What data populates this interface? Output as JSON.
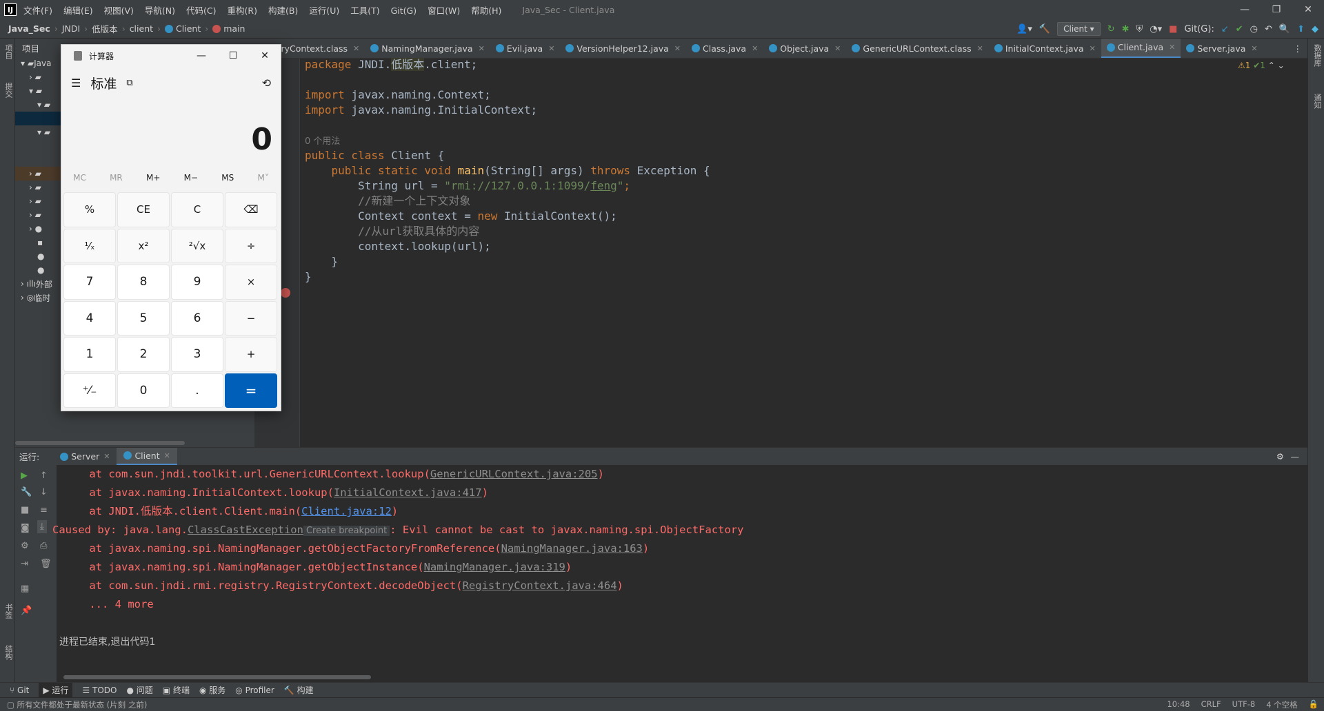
{
  "titlebar": {
    "logo": "IJ",
    "menu": [
      "文件(F)",
      "编辑(E)",
      "视图(V)",
      "导航(N)",
      "代码(C)",
      "重构(R)",
      "构建(B)",
      "运行(U)",
      "工具(T)",
      "Git(G)",
      "窗口(W)",
      "帮助(H)"
    ],
    "window_title": "Java_Sec - Client.java",
    "minimize": "—",
    "restore": "❐",
    "close": "✕"
  },
  "navbar": {
    "breadcrumbs": [
      "Java_Sec",
      "JNDI",
      "低版本",
      "client",
      "Client",
      "main"
    ],
    "run_config": "Client",
    "git_label": "Git(G):"
  },
  "left_strip": {
    "project": "项目",
    "commit": "提交",
    "bookmarks": "书签",
    "structure": "结构"
  },
  "right_strip": {
    "database": "数据库",
    "notifications": "通知"
  },
  "project_panel": {
    "title": "项目",
    "rows": [
      "Java",
      "",
      "",
      "",
      "",
      "",
      "",
      "",
      "",
      "",
      "",
      "",
      "",
      "",
      "",
      "外部",
      "临时"
    ]
  },
  "editor_tabs": [
    {
      "label": "egistryContext.class",
      "active": false
    },
    {
      "label": "NamingManager.java",
      "active": false
    },
    {
      "label": "Evil.java",
      "active": false
    },
    {
      "label": "VersionHelper12.java",
      "active": false
    },
    {
      "label": "Class.java",
      "active": false
    },
    {
      "label": "Object.java",
      "active": false
    },
    {
      "label": "GenericURLContext.class",
      "active": false
    },
    {
      "label": "InitialContext.java",
      "active": false
    },
    {
      "label": "Client.java",
      "active": true
    },
    {
      "label": "Server.java",
      "active": false
    }
  ],
  "inspection": {
    "warnings": "⚠1",
    "ok": "✔1"
  },
  "code": {
    "l1_kw": "package ",
    "l1_pkg1": "JNDI.",
    "l1_pkg2": "低版本",
    "l1_pkg3": ".client;",
    "l3_kw": "import ",
    "l3_rest": "javax.naming.Context;",
    "l4_kw": "import ",
    "l4_rest": "javax.naming.InitialContext;",
    "usage_hint": "0 个用法",
    "l6_kw": "public class ",
    "l6_rest": "Client {",
    "l7_kw1": "    public static void ",
    "l7_fn": "main",
    "l7_mid": "(String[] args) ",
    "l7_kw2": "throws ",
    "l7_end": "Exception {",
    "l8_a": "        String url = ",
    "l8_str1": "\"rmi://127.0.0.1:1099/",
    "l8_str2": "feng",
    "l8_str3": "\"",
    "l8_end": ";",
    "l9_cmt": "        //新建一个上下文对象",
    "l10_a": "        Context context = ",
    "l10_kw": "new ",
    "l10_end": "InitialContext();",
    "l11_cmt": "        //从url获取具体的内容",
    "l12": "        context.lookup(url);",
    "l13": "    }",
    "l14": "}"
  },
  "run_panel": {
    "label": "运行:",
    "tabs": [
      {
        "label": "Server",
        "active": false
      },
      {
        "label": "Client",
        "active": true
      }
    ]
  },
  "console": {
    "l1_a": "    at com.sun.jndi.toolkit.url.GenericURLContext.lookup(",
    "l1_link": "GenericURLContext.java:205",
    "l1_b": ")",
    "l2_a": "    at javax.naming.InitialContext.lookup(",
    "l2_link": "InitialContext.java:417",
    "l2_b": ")",
    "l3_a": "    at JNDI.低版本.client.Client.main(",
    "l3_link": "Client.java:12",
    "l3_b": ")",
    "l4_a": "Caused by: java.lang.",
    "l4_link": "ClassCastException",
    "l4_bp": "Create breakpoint",
    "l4_b": ": Evil cannot be cast to javax.naming.spi.ObjectFactory",
    "l5_a": "    at javax.naming.spi.NamingManager.getObjectFactoryFromReference(",
    "l5_link": "NamingManager.java:163",
    "l5_b": ")",
    "l6_a": "    at javax.naming.spi.NamingManager.getObjectInstance(",
    "l6_link": "NamingManager.java:319",
    "l6_b": ")",
    "l7_a": "    at com.sun.jndi.rmi.registry.RegistryContext.decodeObject(",
    "l7_link": "RegistryContext.java:464",
    "l7_b": ")",
    "l8": "    ... 4 more",
    "exit": "进程已结束,退出代码1"
  },
  "bottom_tools": [
    "Git",
    "运行",
    "TODO",
    "问题",
    "终端",
    "服务",
    "Profiler",
    "构建"
  ],
  "status": {
    "message": "所有文件都处于最新状态 (片刻 之前)",
    "position": "10:48",
    "line_sep": "CRLF",
    "encoding": "UTF-8",
    "indent": "4 个空格"
  },
  "calculator": {
    "title": "计算器",
    "mode": "标准",
    "display": "0",
    "memory": [
      "MC",
      "MR",
      "M+",
      "M−",
      "MS",
      "M˅"
    ],
    "keys": [
      "%",
      "CE",
      "C",
      "⌫",
      "¹⁄ₓ",
      "x²",
      "²√x",
      "÷",
      "7",
      "8",
      "9",
      "×",
      "4",
      "5",
      "6",
      "−",
      "1",
      "2",
      "3",
      "+",
      "⁺⁄₋",
      "0",
      ".",
      "="
    ],
    "minimize": "—",
    "maximize": "☐",
    "close": "✕"
  }
}
